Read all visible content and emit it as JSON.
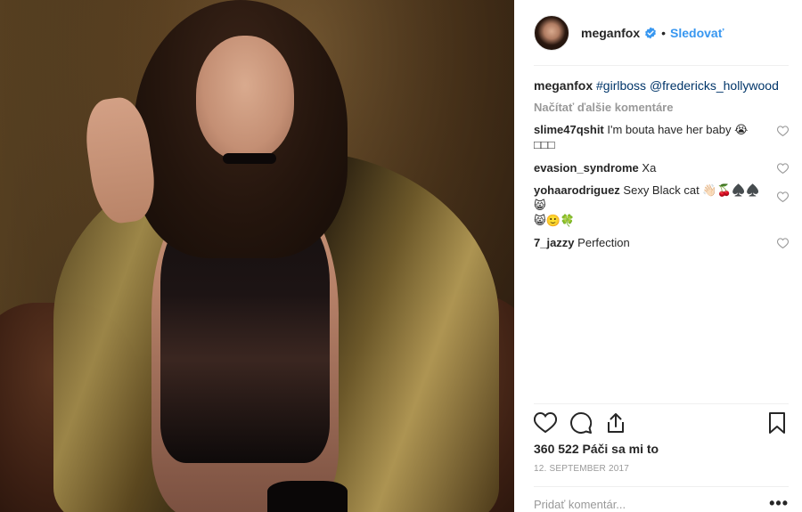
{
  "post": {
    "image_alt": "Post photo"
  },
  "header": {
    "username": "meganfox",
    "separator": "•",
    "follow_label": "Sledovať",
    "verified_icon": "verified-badge-icon"
  },
  "caption": {
    "username": "meganfox",
    "tag": "#girlboss",
    "mention": "@fredericks_hollywood"
  },
  "load_more_label": "Načítať ďalšie komentáre",
  "comments": [
    {
      "username": "slime47qshit",
      "text": "I'm bouta have her baby 😭",
      "text2": "□□□"
    },
    {
      "username": "evasion_syndrome",
      "text": "Xa",
      "text2": ""
    },
    {
      "username": "yohaarodriguez",
      "text": "Sexy Black cat 👋🏻🍒♠️♠️😸",
      "text2": "😸🙂🍀"
    },
    {
      "username": "7_jazzy",
      "text": "Perfection",
      "text2": ""
    }
  ],
  "actions": {
    "like_icon": "heart-outline-icon",
    "comment_icon": "comment-bubble-icon",
    "share_icon": "share-upload-icon",
    "save_icon": "bookmark-icon"
  },
  "likes_text": "360 522 Páči sa mi to",
  "date_text": "12. SEPTEMBER 2017",
  "add_comment": {
    "placeholder": "Pridať komentár...",
    "more_label": "•••"
  },
  "colors": {
    "link_blue": "#3897f0",
    "text": "#262626",
    "muted": "#999999",
    "divider": "#efefef"
  }
}
